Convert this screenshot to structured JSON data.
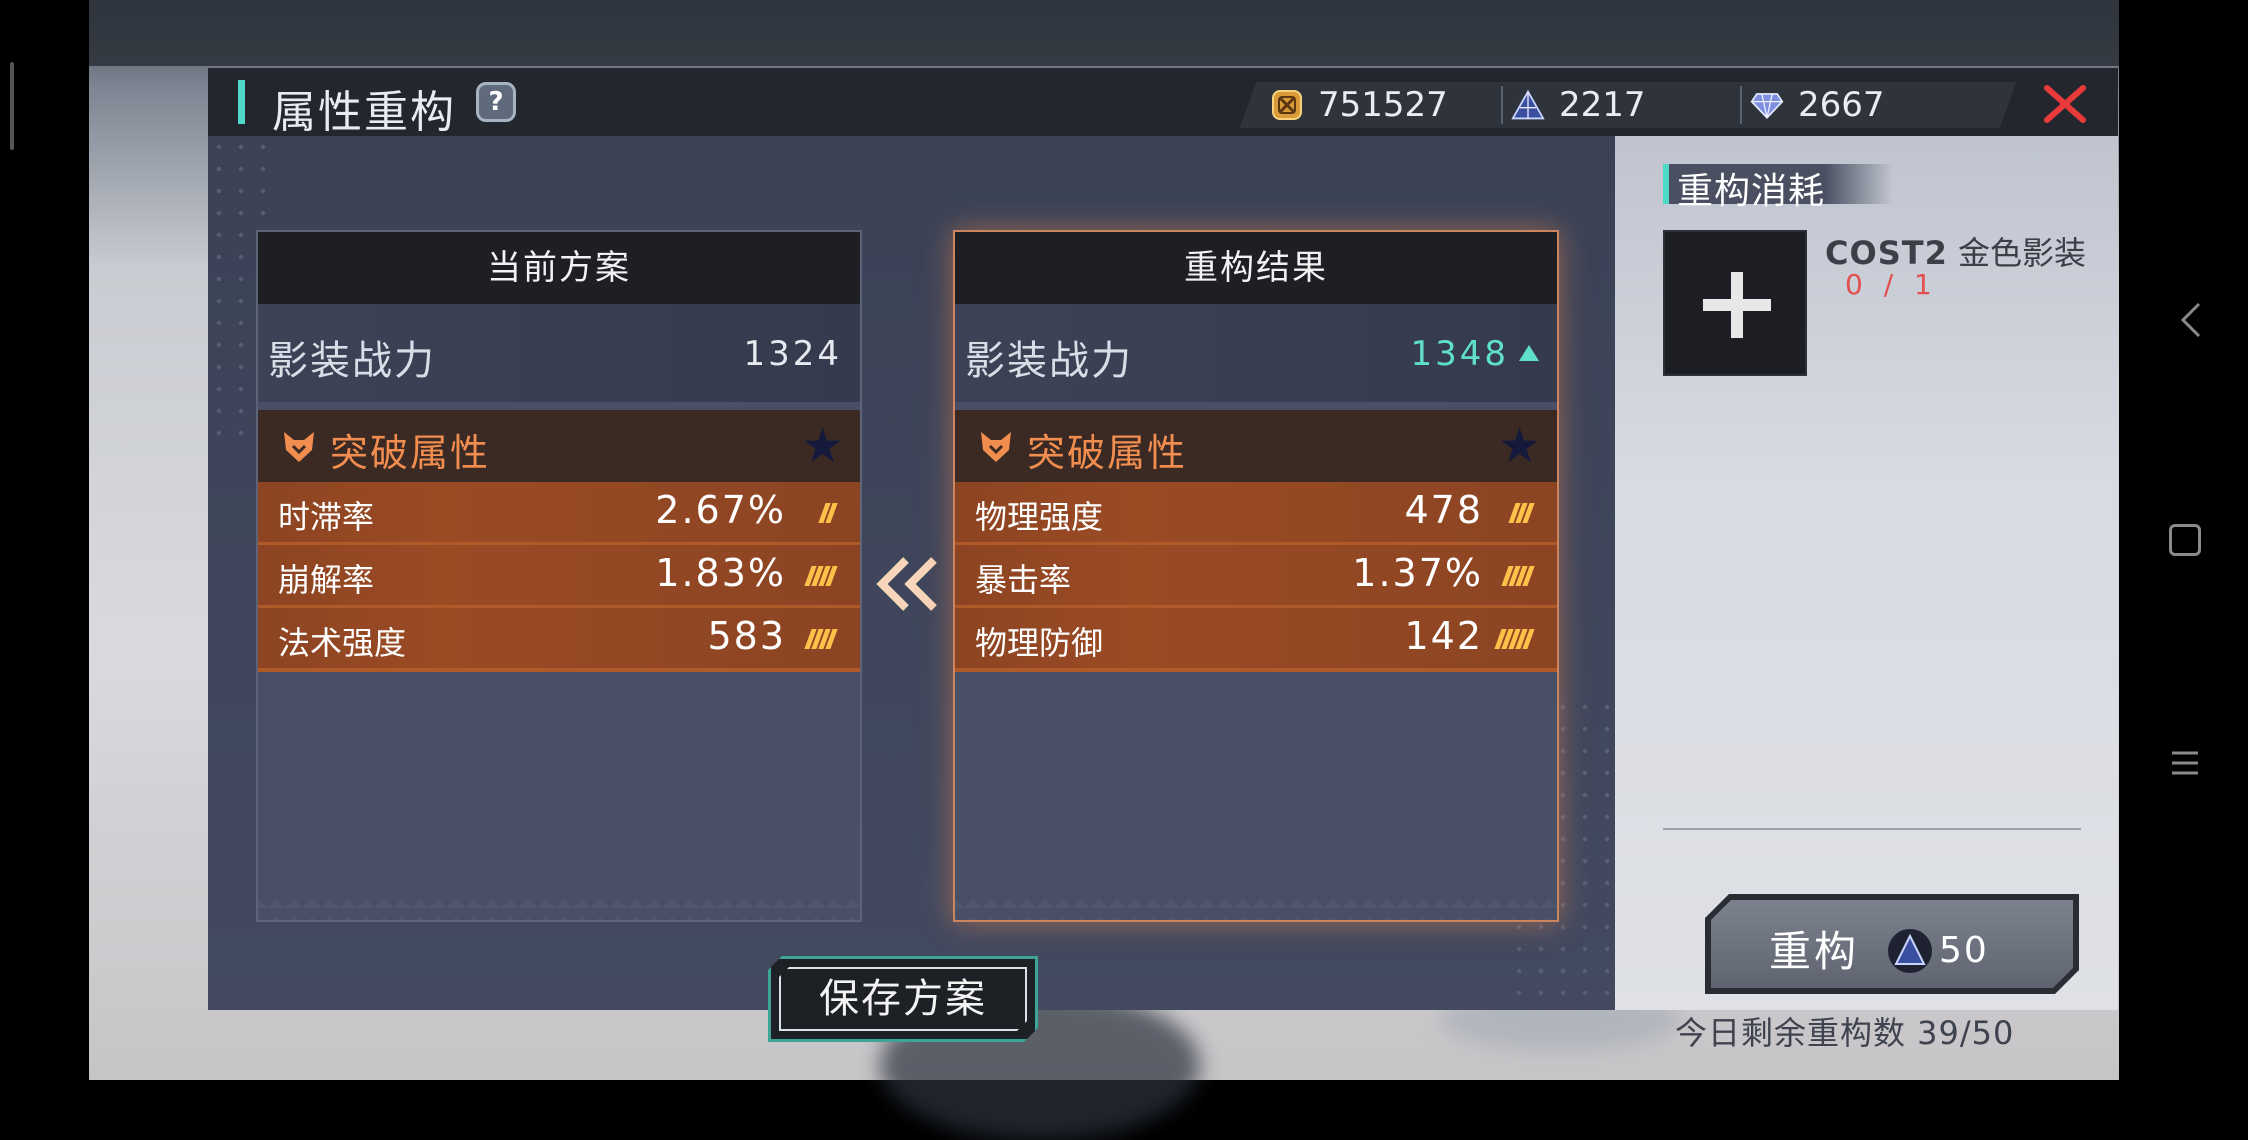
{
  "header": {
    "title": "属性重构",
    "help_label": "?",
    "currencies": [
      {
        "icon": "gold-coin-icon",
        "value": "751527"
      },
      {
        "icon": "crystal-pyramid-icon",
        "value": "2217"
      },
      {
        "icon": "diamond-icon",
        "value": "2667"
      }
    ]
  },
  "current_plan": {
    "header": "当前方案",
    "power_label": "影装战力",
    "power_value": "1324",
    "breakthrough_label": "突破属性",
    "attributes": [
      {
        "name": "时滞率",
        "value": "2.67%"
      },
      {
        "name": "崩解率",
        "value": "1.83%"
      },
      {
        "name": "法术强度",
        "value": "583"
      }
    ]
  },
  "result_plan": {
    "header": "重构结果",
    "power_label": "影装战力",
    "power_value": "1348",
    "breakthrough_label": "突破属性",
    "attributes": [
      {
        "name": "物理强度",
        "value": "478"
      },
      {
        "name": "暴击率",
        "value": "1.37%"
      },
      {
        "name": "物理防御",
        "value": "142"
      }
    ]
  },
  "save_button": "保存方案",
  "cost": {
    "title": "重构消耗",
    "item_cost_tag": "COST2",
    "item_name": "金色影装",
    "item_count": "0 / 1",
    "rebuild_label": "重构",
    "rebuild_cost": "50",
    "remaining_text": "今日剩余重构数 39/50"
  },
  "colors": {
    "accent_teal": "#4fd9c9",
    "attr_orange": "#f08d4f",
    "power_up": "#5fe0c9",
    "close_red": "#e83a3a"
  }
}
